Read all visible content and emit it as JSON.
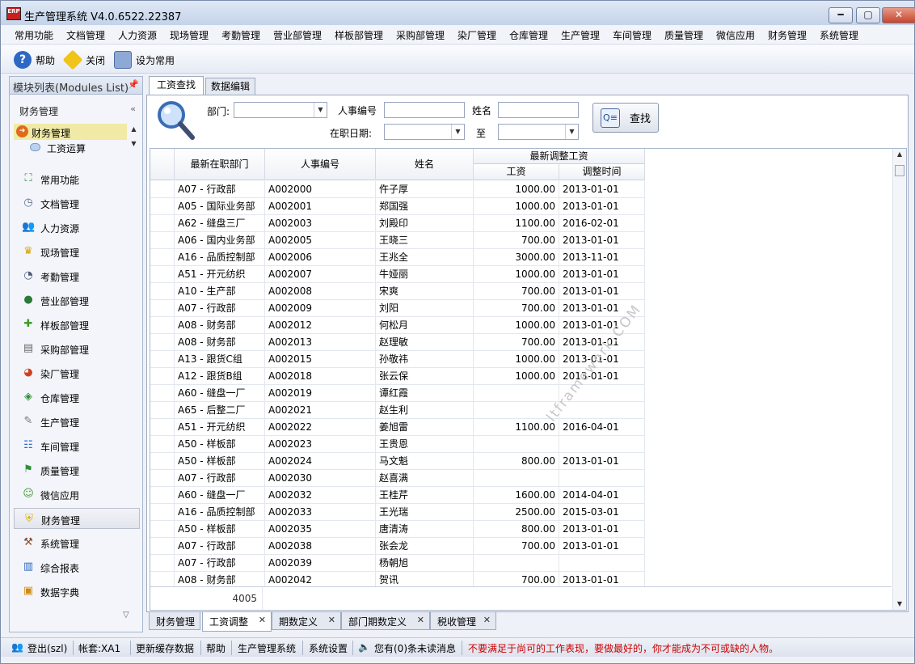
{
  "app": {
    "title": "生产管理系统 V4.0.6522.22387",
    "logo_text": "ERP"
  },
  "window_controls": {
    "minimize": "━",
    "maximize": "▢",
    "close": "✕"
  },
  "menu": [
    "常用功能",
    "文档管理",
    "人力资源",
    "现场管理",
    "考勤管理",
    "营业部管理",
    "样板部管理",
    "采购部管理",
    "染厂管理",
    "仓库管理",
    "生产管理",
    "车间管理",
    "质量管理",
    "微信应用",
    "财务管理",
    "系统管理"
  ],
  "toolbar": {
    "help": "帮助",
    "close": "关闭",
    "set_common": "设为常用"
  },
  "left_panel": {
    "title": "模块列表(Modules List)",
    "group": "财务管理",
    "tree": {
      "parent": "财务管理",
      "child": "工资运算"
    },
    "nav": [
      {
        "label": "常用功能",
        "icon": "common-functions-icon"
      },
      {
        "label": "文档管理",
        "icon": "document-icon"
      },
      {
        "label": "人力资源",
        "icon": "people-icon"
      },
      {
        "label": "现场管理",
        "icon": "crown-icon"
      },
      {
        "label": "考勤管理",
        "icon": "clock-icon"
      },
      {
        "label": "营业部管理",
        "icon": "globe-icon"
      },
      {
        "label": "样板部管理",
        "icon": "puzzle-icon"
      },
      {
        "label": "采购部管理",
        "icon": "note-icon"
      },
      {
        "label": "染厂管理",
        "icon": "pie-icon"
      },
      {
        "label": "仓库管理",
        "icon": "box-icon"
      },
      {
        "label": "生产管理",
        "icon": "wrench-icon"
      },
      {
        "label": "车间管理",
        "icon": "org-chart-icon"
      },
      {
        "label": "质量管理",
        "icon": "flag-icon"
      },
      {
        "label": "微信应用",
        "icon": "wechat-icon"
      },
      {
        "label": "财务管理",
        "icon": "shield-icon"
      },
      {
        "label": "系统管理",
        "icon": "tools-icon"
      },
      {
        "label": "综合报表",
        "icon": "bar-chart-icon"
      },
      {
        "label": "数据字典",
        "icon": "dictionary-icon"
      }
    ],
    "active_nav": "财务管理"
  },
  "tabs": {
    "salary_search": "工资查找",
    "data_edit": "数据编辑"
  },
  "search": {
    "dept_label": "部门:",
    "emp_no_label": "人事编号",
    "name_label": "姓名",
    "hire_date_label": "在职日期:",
    "to_label": "至",
    "dept_value": "",
    "emp_no_value": "",
    "name_value": "",
    "date_from": "",
    "date_to": "",
    "button": "查找"
  },
  "grid": {
    "headers": {
      "dept": "最新在职部门",
      "emp_no": "人事编号",
      "name": "姓名",
      "group": "最新调整工资",
      "salary": "工资",
      "adjust_time": "调整时间"
    },
    "rows": [
      {
        "dept": "A07 - 行政部",
        "emp_no": "A002000",
        "name": "仵子厚",
        "salary": "1000.00",
        "time": "2013-01-01"
      },
      {
        "dept": "A05 - 国际业务部",
        "emp_no": "A002001",
        "name": "郑国强",
        "salary": "1000.00",
        "time": "2013-01-01"
      },
      {
        "dept": "A62 - 缝盘三厂",
        "emp_no": "A002003",
        "name": "刘殿印",
        "salary": "1100.00",
        "time": "2016-02-01"
      },
      {
        "dept": "A06 - 国内业务部",
        "emp_no": "A002005",
        "name": "王晓三",
        "salary": "700.00",
        "time": "2013-01-01"
      },
      {
        "dept": "A16 - 品质控制部",
        "emp_no": "A002006",
        "name": "王兆全",
        "salary": "3000.00",
        "time": "2013-11-01"
      },
      {
        "dept": "A51 - 开元纺织",
        "emp_no": "A002007",
        "name": "牛娅丽",
        "salary": "1000.00",
        "time": "2013-01-01"
      },
      {
        "dept": "A10 - 生产部",
        "emp_no": "A002008",
        "name": "宋爽",
        "salary": "700.00",
        "time": "2013-01-01"
      },
      {
        "dept": "A07 - 行政部",
        "emp_no": "A002009",
        "name": "刘阳",
        "salary": "700.00",
        "time": "2013-01-01"
      },
      {
        "dept": "A08 - 财务部",
        "emp_no": "A002012",
        "name": "何松月",
        "salary": "1000.00",
        "time": "2013-01-01"
      },
      {
        "dept": "A08 - 财务部",
        "emp_no": "A002013",
        "name": "赵理敏",
        "salary": "700.00",
        "time": "2013-01-01"
      },
      {
        "dept": "A13 - 跟货C组",
        "emp_no": "A002015",
        "name": "孙敬祎",
        "salary": "1000.00",
        "time": "2013-01-01"
      },
      {
        "dept": "A12 - 跟货B组",
        "emp_no": "A002018",
        "name": "张云保",
        "salary": "1000.00",
        "time": "2013-01-01"
      },
      {
        "dept": "A60 - 缝盘一厂",
        "emp_no": "A002019",
        "name": "谭红霞",
        "salary": "",
        "time": ""
      },
      {
        "dept": "A65 - 后整二厂",
        "emp_no": "A002021",
        "name": "赵生利",
        "salary": "",
        "time": ""
      },
      {
        "dept": "A51 - 开元纺织",
        "emp_no": "A002022",
        "name": "姜旭雷",
        "salary": "1100.00",
        "time": "2016-04-01"
      },
      {
        "dept": "A50 - 样板部",
        "emp_no": "A002023",
        "name": "王贵恩",
        "salary": "",
        "time": ""
      },
      {
        "dept": "A50 - 样板部",
        "emp_no": "A002024",
        "name": "马文魁",
        "salary": "800.00",
        "time": "2013-01-01"
      },
      {
        "dept": "A07 - 行政部",
        "emp_no": "A002030",
        "name": "赵喜满",
        "salary": "",
        "time": ""
      },
      {
        "dept": "A60 - 缝盘一厂",
        "emp_no": "A002032",
        "name": "王桂芹",
        "salary": "1600.00",
        "time": "2014-04-01"
      },
      {
        "dept": "A16 - 品质控制部",
        "emp_no": "A002033",
        "name": "王光瑞",
        "salary": "2500.00",
        "time": "2015-03-01"
      },
      {
        "dept": "A50 - 样板部",
        "emp_no": "A002035",
        "name": "唐清涛",
        "salary": "800.00",
        "time": "2013-01-01"
      },
      {
        "dept": "A07 - 行政部",
        "emp_no": "A002038",
        "name": "张会龙",
        "salary": "700.00",
        "time": "2013-01-01"
      },
      {
        "dept": "A07 - 行政部",
        "emp_no": "A002039",
        "name": "杨朝旭",
        "salary": "",
        "time": ""
      },
      {
        "dept": "A08 - 财务部",
        "emp_no": "A002042",
        "name": "贺讯",
        "salary": "700.00",
        "time": "2013-01-01"
      }
    ],
    "row_count": "4005",
    "watermark": "ltframework.COM"
  },
  "doc_tabs": [
    {
      "label": "财务管理",
      "closable": false
    },
    {
      "label": "工资调整",
      "closable": true,
      "active": true
    },
    {
      "label": "期数定义",
      "closable": true
    },
    {
      "label": "部门期数定义",
      "closable": true
    },
    {
      "label": "税收管理",
      "closable": true
    }
  ],
  "status": {
    "logout": "登出(szl)",
    "account": "帐套:XA1",
    "refresh_cache": "更新缓存数据",
    "help": "帮助",
    "system": "生产管理系统",
    "settings": "系统设置",
    "messages": "您有(0)条未读消息",
    "motto": "不要满足于尚可的工作表现，要做最好的，你才能成为不可或缺的人物。",
    "motto_color": "#cc0000"
  }
}
